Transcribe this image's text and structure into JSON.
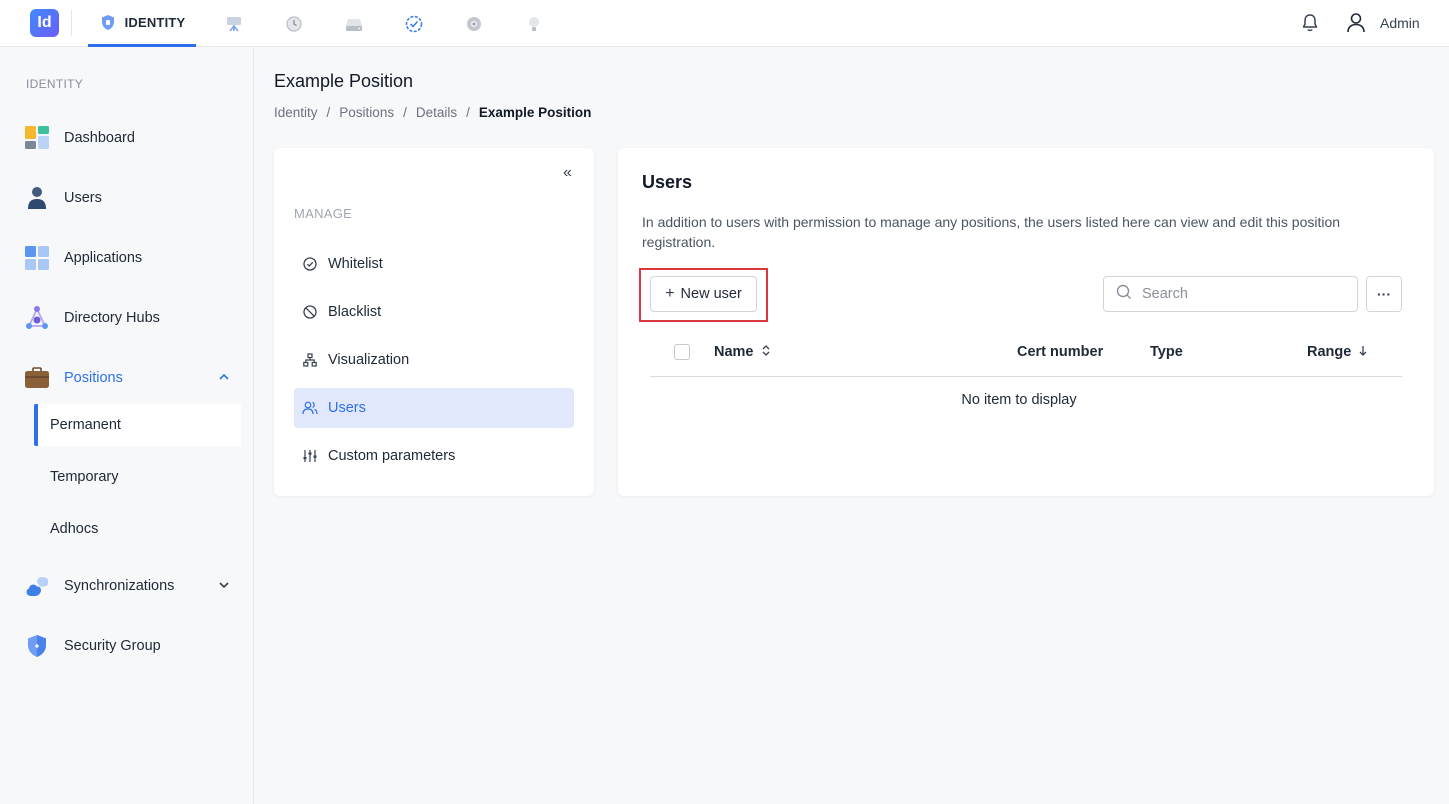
{
  "topbar": {
    "logo_text": "Id",
    "active_app": "IDENTITY",
    "user_name": "Admin"
  },
  "sidebar": {
    "section": "IDENTITY",
    "items": [
      {
        "label": "Dashboard"
      },
      {
        "label": "Users"
      },
      {
        "label": "Applications"
      },
      {
        "label": "Directory Hubs"
      },
      {
        "label": "Positions"
      },
      {
        "label": "Synchronizations"
      },
      {
        "label": "Security Group"
      }
    ],
    "positions_sub": [
      {
        "label": "Permanent"
      },
      {
        "label": "Temporary"
      },
      {
        "label": "Adhocs"
      }
    ]
  },
  "page": {
    "title": "Example Position",
    "breadcrumb": [
      "Identity",
      "Positions",
      "Details",
      "Example Position"
    ]
  },
  "manage": {
    "collapse": "«",
    "label": "MANAGE",
    "items": [
      {
        "label": "Whitelist"
      },
      {
        "label": "Blacklist"
      },
      {
        "label": "Visualization"
      },
      {
        "label": "Users"
      },
      {
        "label": "Custom parameters"
      }
    ]
  },
  "users_panel": {
    "title": "Users",
    "description": "In addition to users with permission to manage any positions, the users listed here can view and edit this position registration.",
    "new_user_label": "New user",
    "search_placeholder": "Search",
    "more": "···",
    "columns": [
      "Name",
      "Cert number",
      "Type",
      "Range"
    ],
    "empty": "No item to display"
  },
  "colors": {
    "accent": "#2f6fea",
    "highlight": "#d9363e",
    "active_bg": "#e1e8fb"
  }
}
